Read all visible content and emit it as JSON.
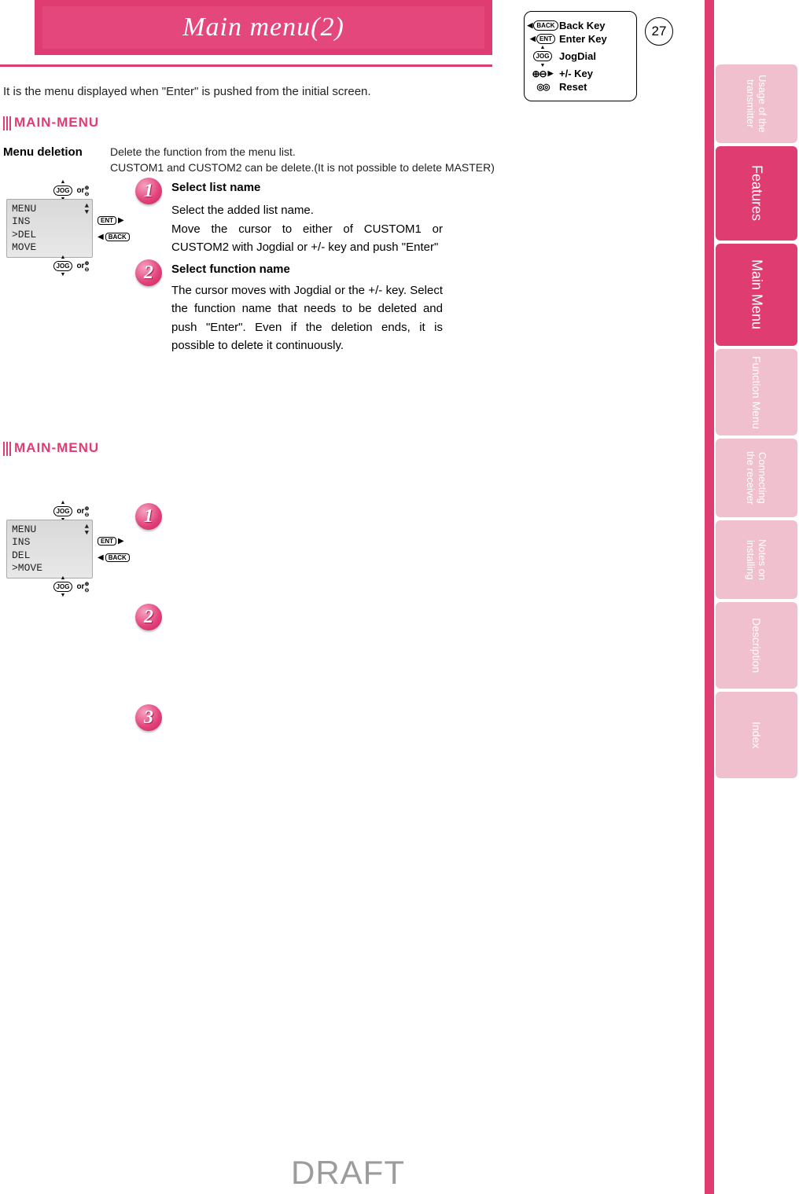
{
  "page_number": "27",
  "title": "Main menu(2)",
  "intro": "It is the menu displayed when \"Enter\" is pushed from the initial screen.",
  "main_menu_heading": "MAIN-MENU",
  "legend": {
    "back": "Back Key",
    "enter": "Enter Key",
    "jog": "JogDial",
    "plusminus": "+/- Key",
    "reset": "Reset",
    "icon_back": "BACK",
    "icon_ent": "ENT",
    "icon_jog": "JOG"
  },
  "side_tabs": {
    "t1a": "Usage of the",
    "t1b": "transmitter",
    "t2": "Features",
    "t3": "Main Menu",
    "t4": "Function Menu",
    "t5a": "Connecting",
    "t5b": "the receiver",
    "t6a": "Notes on",
    "t6b": "installing",
    "t7": "Description",
    "t8": "Index"
  },
  "section1": {
    "label": "Menu deletion",
    "desc1": "Delete the function from the menu list.",
    "desc2": "CUSTOM1 and CUSTOM2 can be delete.(It is not possible to delete MASTER)",
    "lcd": {
      "l1": "MENU",
      "l2": " INS",
      "l3": ">DEL",
      "l4": " MOVE"
    },
    "or": "or",
    "ent": "ENT",
    "back": "BACK",
    "jog": "JOG",
    "step1_title": "Select list name",
    "step1_body1": "Select the added list name.",
    "step1_body2": "Move the cursor to either of CUSTOM1 or CUSTOM2 with Jogdial or +/- key and push \"Enter\"",
    "step2_title": "Select function name",
    "step2_body": "The cursor moves with Jogdial or the +/- key. Select the function name that needs to be deleted and push \"Enter\". Even if the deletion ends, it is possible to delete it continuously."
  },
  "section2": {
    "lcd": {
      "l1": "MENU",
      "l2": " INS",
      "l3": " DEL",
      "l4": ">MOVE"
    }
  },
  "watermark": "DRAFT"
}
